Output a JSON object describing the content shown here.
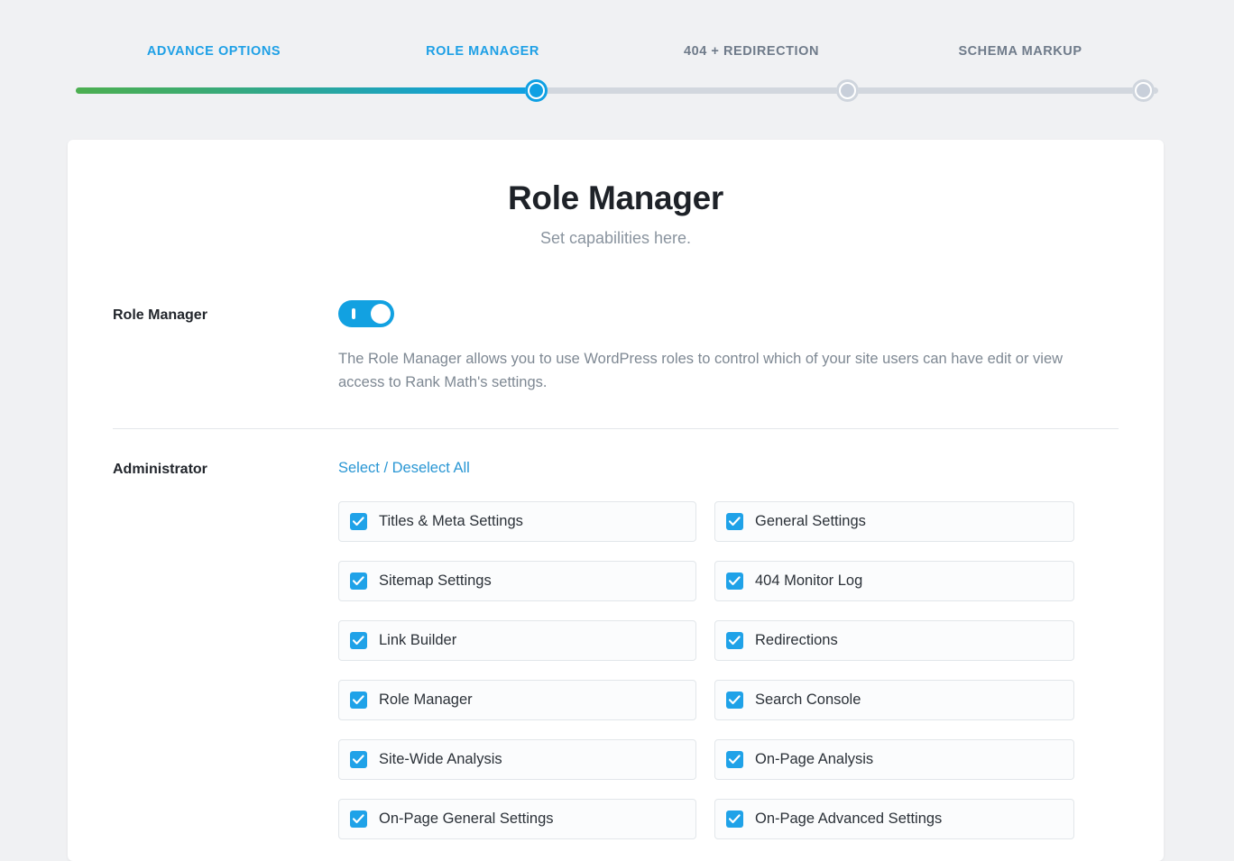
{
  "wizard": {
    "steps": [
      {
        "label": "ADVANCE OPTIONS",
        "state": "done"
      },
      {
        "label": "ROLE MANAGER",
        "state": "active"
      },
      {
        "label": "404 + REDIRECTION",
        "state": "todo"
      },
      {
        "label": "SCHEMA MARKUP",
        "state": "todo"
      }
    ],
    "progress_percent": 42.5,
    "fill_start_color": "#4caf50",
    "fill_end_color": "#0fa0e3",
    "track_color": "#d2d7de",
    "active_color": "#1ea0e6",
    "inactive_label_color": "#6f7b8a"
  },
  "card": {
    "title": "Role Manager",
    "subtitle": "Set capabilities here."
  },
  "role_manager_setting": {
    "label": "Role Manager",
    "toggle_state": "on",
    "toggle_color": "#12a1e1",
    "description": "The Role Manager allows you to use WordPress roles to control which of your site users can have edit or view access to Rank Math's settings."
  },
  "administrator": {
    "label": "Administrator",
    "select_all_label": "Select / Deselect All",
    "select_all_color": "#2a97d4",
    "capabilities": [
      {
        "label": "Titles & Meta Settings",
        "checked": true
      },
      {
        "label": "General Settings",
        "checked": true
      },
      {
        "label": "Sitemap Settings",
        "checked": true
      },
      {
        "label": "404 Monitor Log",
        "checked": true
      },
      {
        "label": "Link Builder",
        "checked": true
      },
      {
        "label": "Redirections",
        "checked": true
      },
      {
        "label": "Role Manager",
        "checked": true
      },
      {
        "label": "Search Console",
        "checked": true
      },
      {
        "label": "Site-Wide Analysis",
        "checked": true
      },
      {
        "label": "On-Page Analysis",
        "checked": true
      },
      {
        "label": "On-Page General Settings",
        "checked": true
      },
      {
        "label": "On-Page Advanced Settings",
        "checked": true
      }
    ],
    "checkbox_color": "#1fa2e8"
  }
}
